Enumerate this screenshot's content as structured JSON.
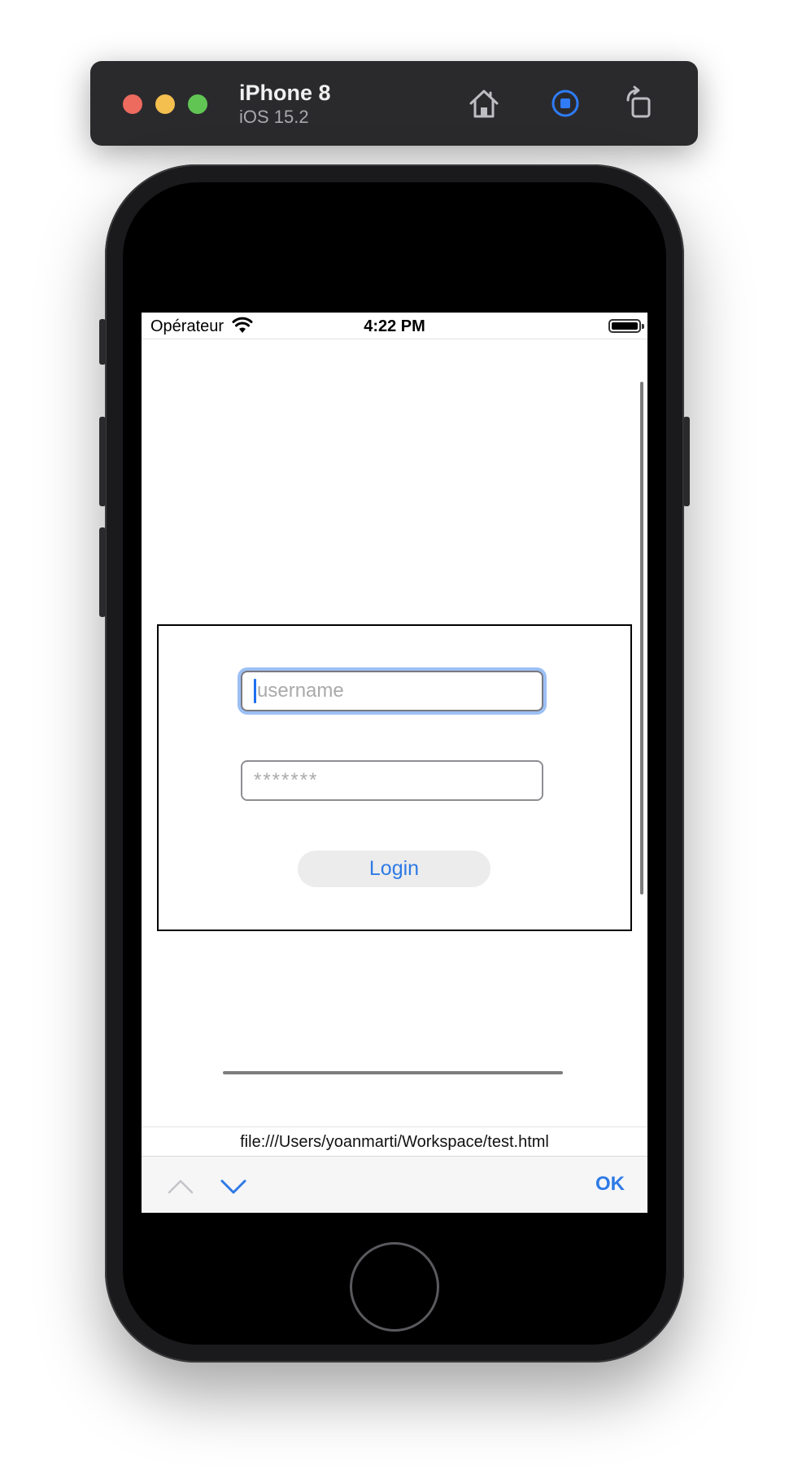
{
  "simulator": {
    "device_name": "iPhone 8",
    "os_version": "iOS 15.2"
  },
  "status_bar": {
    "carrier": "Opérateur",
    "time": "4:22 PM"
  },
  "login_form": {
    "username_placeholder": "username",
    "password_placeholder": "*******",
    "login_label": "Login"
  },
  "url_bar": {
    "url": "file:///Users/yoanmarti/Workspace/test.html"
  },
  "input_toolbar": {
    "ok_label": "OK"
  },
  "colors": {
    "accent": "#2e7ae6",
    "focus_ring": "#9cc0f5",
    "toolbar_bg": "#2a2a2d"
  }
}
